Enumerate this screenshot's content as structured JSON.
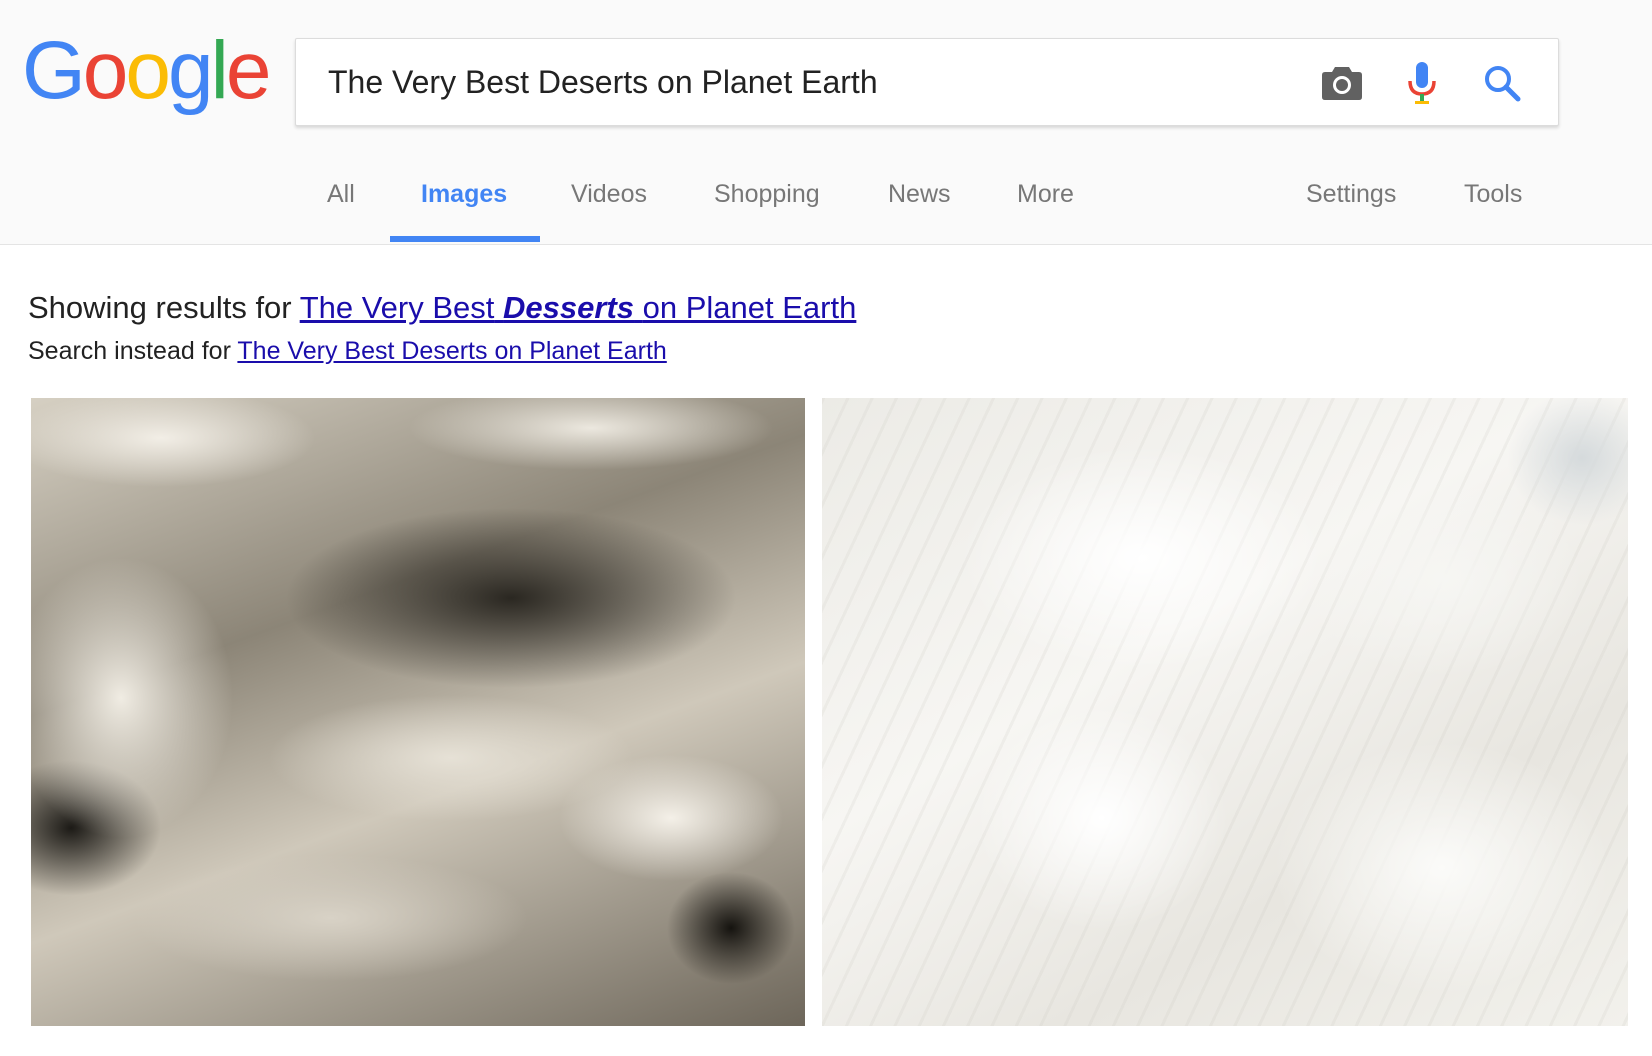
{
  "logo": {
    "letters": [
      "G",
      "o",
      "o",
      "g",
      "l",
      "e"
    ],
    "colors": [
      "#4285f4",
      "#ea4335",
      "#fbbc05",
      "#4285f4",
      "#34a853",
      "#ea4335"
    ]
  },
  "search": {
    "query": "The Very Best Deserts on Planet Earth",
    "icons": [
      "camera-icon",
      "microphone-icon",
      "search-icon"
    ]
  },
  "tabs": {
    "all": "All",
    "images": "Images",
    "videos": "Videos",
    "shopping": "Shopping",
    "news": "News",
    "more": "More",
    "settings": "Settings",
    "tools": "Tools",
    "active": "Images",
    "active_color": "#4285f4"
  },
  "correction": {
    "prefix": "Showing results for",
    "link_before": "The Very Best",
    "link_emphasis": "Desserts",
    "link_after": "on Planet Earth",
    "instead_prefix": "Search instead for",
    "instead_link": "The Very Best Deserts on Planet Earth",
    "link_color": "#1a0dab"
  }
}
